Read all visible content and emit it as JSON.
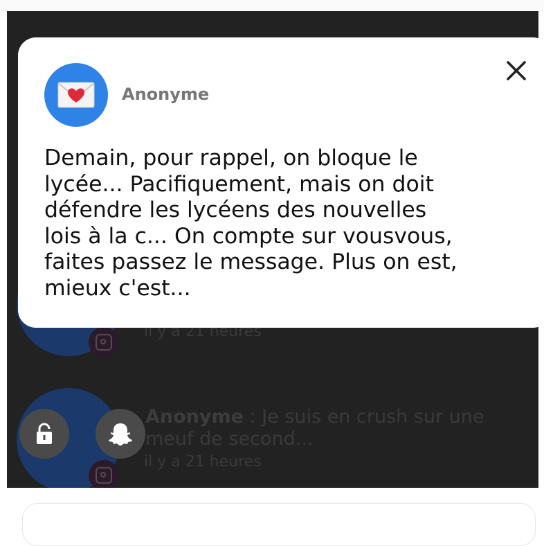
{
  "popup": {
    "sender": "Anonyme",
    "message": "Demain, pour rappel, on bloque le\nlycée... Pacifiquement, mais on doit\ndéfendre les lycéens des nouvelles\nlois à la c... On compte sur vousvous,\nfaites passez le message. Plus on est,\nmieux c'est...",
    "avatar_icon": "envelope-heart-icon",
    "close_icon": "close-icon"
  },
  "feed": {
    "item1": {
      "time": "il y a 21 heures"
    },
    "item2": {
      "sender": "Anonyme",
      "separator": " : ",
      "line1": "Je suis en crush sur une",
      "line2": "meuf de second...",
      "time": "il y a 21 heures"
    }
  },
  "floating": {
    "lock_icon": "lock-icon",
    "snapchat_icon": "snapchat-ghost-icon"
  },
  "colors": {
    "backdrop": "#222222",
    "avatar_blue": "#2f82e6",
    "popup_bg": "#ffffff"
  }
}
